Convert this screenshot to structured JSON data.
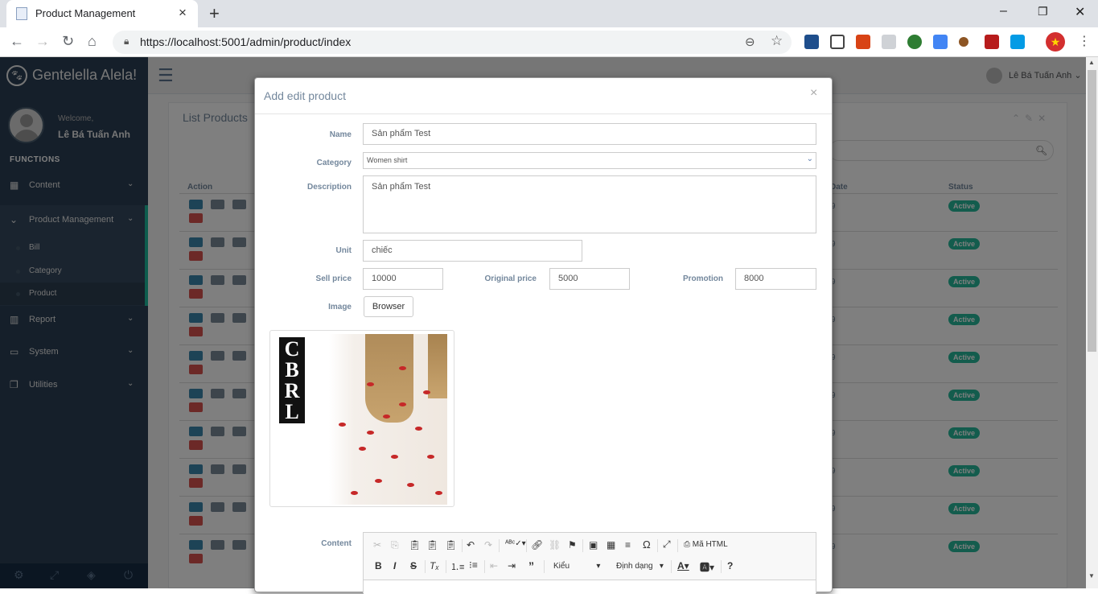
{
  "browser": {
    "tab_title": "Product Management",
    "url": "https://localhost:5001/admin/product/index",
    "new_tab": "+",
    "window_min": "–",
    "window_max": "❐",
    "window_close": "✕"
  },
  "sidebar": {
    "brand": "Gentelella Alela!",
    "welcome": "Welcome,",
    "user": "Lê Bá Tuấn Anh",
    "section": "FUNCTIONS",
    "menu": {
      "content": "Content",
      "product_mgmt": "Product Management",
      "report": "Report",
      "system": "System",
      "utilities": "Utilities"
    },
    "submenu": {
      "bill": "Bill",
      "category": "Category",
      "product": "Product"
    }
  },
  "topnav": {
    "user": "Lê Bá Tuấn Anh"
  },
  "panel": {
    "title": "List Products",
    "col_action": "Action",
    "col_date": "Date",
    "col_status": "Status",
    "row_date_suffix": "9",
    "status_active": "Active",
    "row_count": 10
  },
  "modal": {
    "title": "Add edit product",
    "close": "×",
    "labels": {
      "name": "Name",
      "category": "Category",
      "description": "Description",
      "unit": "Unit",
      "sell_price": "Sell price",
      "original_price": "Original price",
      "promotion": "Promotion",
      "image": "Image",
      "content": "Content"
    },
    "values": {
      "name": "Sản phẩm Test",
      "category": "Women shirt",
      "description": "Sản phẩm Test",
      "unit": "chiếc",
      "sell_price": "10000",
      "original_price": "5000",
      "promotion": "8000"
    },
    "browse_button": "Browser",
    "image_logo_text": "CBRL",
    "editor": {
      "source": "Mã HTML",
      "styles": "Kiểu",
      "format": "Định dạng"
    }
  },
  "colors": {
    "sidebar_bg": "#2a3f54",
    "accent": "#1abb9c",
    "active_badge": "#26b99a",
    "edit_btn": "#3a87ad",
    "delete_btn": "#d9534f"
  }
}
